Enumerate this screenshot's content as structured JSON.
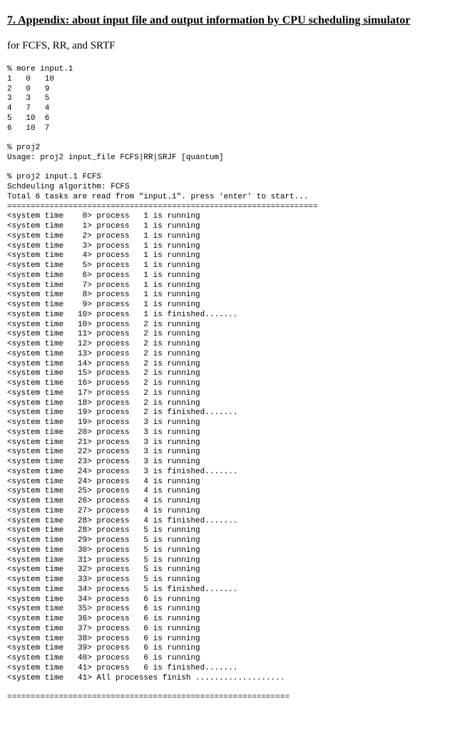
{
  "title": "7. Appendix: about input file and output information by CPU scheduling simulator",
  "subhead": "for FCFS, RR, and SRTF",
  "cmd_more": "% more input.1",
  "input_rows": [
    "1   0   10",
    "2   0   9",
    "3   3   5",
    "4   7   4",
    "5   10  6",
    "6   10  7"
  ],
  "cmd_proj2": "% proj2",
  "usage": "Usage: proj2 input_file FCFS|RR|SRJF [quantum]",
  "cmd_run": "% proj2 input.1 FCFS",
  "algo_line": "Schdeuling algorithm: FCFS",
  "tasks_line": "Total 6 tasks are read from \"input.1\". press 'enter' to start...",
  "hrule1": "==================================================================",
  "trace": [
    {
      "t": 0,
      "p": 1,
      "s": "running"
    },
    {
      "t": 1,
      "p": 1,
      "s": "running"
    },
    {
      "t": 2,
      "p": 1,
      "s": "running"
    },
    {
      "t": 3,
      "p": 1,
      "s": "running"
    },
    {
      "t": 4,
      "p": 1,
      "s": "running"
    },
    {
      "t": 5,
      "p": 1,
      "s": "running"
    },
    {
      "t": 6,
      "p": 1,
      "s": "running"
    },
    {
      "t": 7,
      "p": 1,
      "s": "running"
    },
    {
      "t": 8,
      "p": 1,
      "s": "running"
    },
    {
      "t": 9,
      "p": 1,
      "s": "running"
    },
    {
      "t": 10,
      "p": 1,
      "s": "finished"
    },
    {
      "t": 10,
      "p": 2,
      "s": "running"
    },
    {
      "t": 11,
      "p": 2,
      "s": "running"
    },
    {
      "t": 12,
      "p": 2,
      "s": "running"
    },
    {
      "t": 13,
      "p": 2,
      "s": "running"
    },
    {
      "t": 14,
      "p": 2,
      "s": "running"
    },
    {
      "t": 15,
      "p": 2,
      "s": "running"
    },
    {
      "t": 16,
      "p": 2,
      "s": "running"
    },
    {
      "t": 17,
      "p": 2,
      "s": "running"
    },
    {
      "t": 18,
      "p": 2,
      "s": "running"
    },
    {
      "t": 19,
      "p": 2,
      "s": "finished"
    },
    {
      "t": 19,
      "p": 3,
      "s": "running"
    },
    {
      "t": 20,
      "p": 3,
      "s": "running"
    },
    {
      "t": 21,
      "p": 3,
      "s": "running"
    },
    {
      "t": 22,
      "p": 3,
      "s": "running"
    },
    {
      "t": 23,
      "p": 3,
      "s": "running"
    },
    {
      "t": 24,
      "p": 3,
      "s": "finished"
    },
    {
      "t": 24,
      "p": 4,
      "s": "running"
    },
    {
      "t": 25,
      "p": 4,
      "s": "running"
    },
    {
      "t": 26,
      "p": 4,
      "s": "running"
    },
    {
      "t": 27,
      "p": 4,
      "s": "running"
    },
    {
      "t": 28,
      "p": 4,
      "s": "finished"
    },
    {
      "t": 28,
      "p": 5,
      "s": "running"
    },
    {
      "t": 29,
      "p": 5,
      "s": "running"
    },
    {
      "t": 30,
      "p": 5,
      "s": "running"
    },
    {
      "t": 31,
      "p": 5,
      "s": "running"
    },
    {
      "t": 32,
      "p": 5,
      "s": "running"
    },
    {
      "t": 33,
      "p": 5,
      "s": "running"
    },
    {
      "t": 34,
      "p": 5,
      "s": "finished"
    },
    {
      "t": 34,
      "p": 6,
      "s": "running"
    },
    {
      "t": 35,
      "p": 6,
      "s": "running"
    },
    {
      "t": 36,
      "p": 6,
      "s": "running"
    },
    {
      "t": 37,
      "p": 6,
      "s": "running"
    },
    {
      "t": 38,
      "p": 6,
      "s": "running"
    },
    {
      "t": 39,
      "p": 6,
      "s": "running"
    },
    {
      "t": 40,
      "p": 6,
      "s": "running"
    },
    {
      "t": 41,
      "p": 6,
      "s": "finished"
    }
  ],
  "final_line_time": 41,
  "final_line_msg": "All processes finish ...................",
  "hrule2": "============================================================"
}
